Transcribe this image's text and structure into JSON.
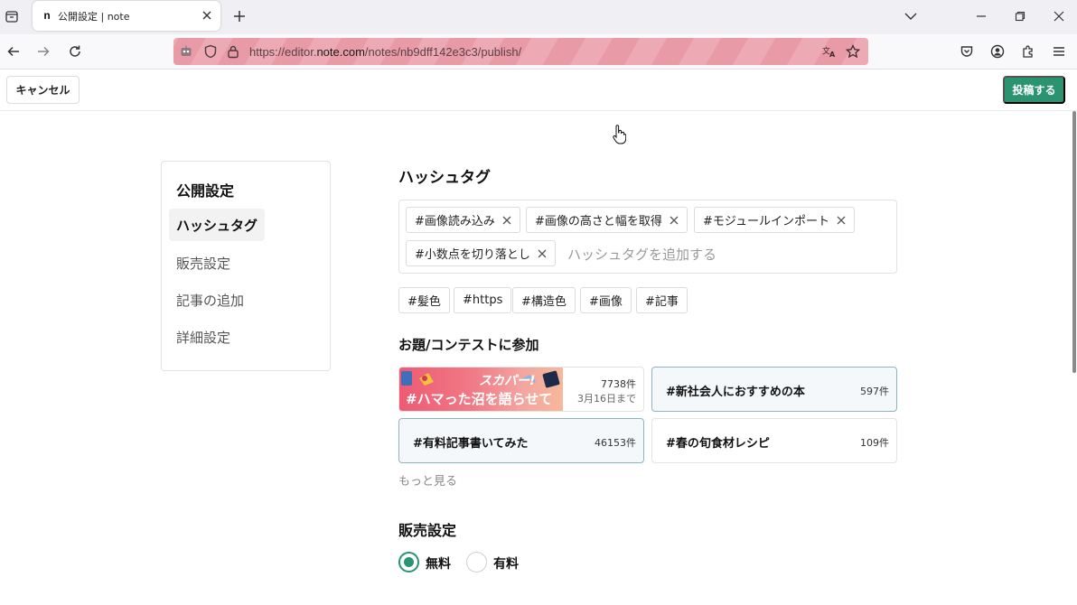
{
  "browser": {
    "tab": {
      "favicon": "n",
      "title": "公開設定 | note"
    },
    "url": {
      "prefix": "https://editor.",
      "host": "note.com",
      "path": "/notes/nb9dff142e3c3/publish/"
    },
    "icons": {
      "tab_list": "tab-list-icon",
      "new_tab": "plus-icon",
      "back": "arrow-left-icon",
      "forward": "arrow-right-icon",
      "reload": "reload-icon",
      "translate": "translate-icon",
      "bookmark": "star-icon",
      "pocket": "pocket-icon",
      "account": "account-icon",
      "extensions": "puzzle-icon",
      "menu": "hamburger-icon"
    }
  },
  "header": {
    "cancel_label": "キャンセル",
    "publish_label": "投稿する"
  },
  "sidebar": {
    "title": "公開設定",
    "items": [
      {
        "label": "ハッシュタグ",
        "active": true
      },
      {
        "label": "販売設定",
        "active": false
      },
      {
        "label": "記事の追加",
        "active": false
      },
      {
        "label": "詳細設定",
        "active": false
      }
    ]
  },
  "hashtags": {
    "heading": "ハッシュタグ",
    "selected": [
      "#画像読み込み",
      "#画像の高さと幅を取得",
      "#モジュールインポート",
      "#小数点を切り落とし"
    ],
    "input_placeholder": "ハッシュタグを追加する",
    "suggestions": [
      "#髪色",
      "#https",
      "#構造色",
      "#画像",
      "#記事"
    ]
  },
  "contest": {
    "heading": "お題/コンテストに参加",
    "featured": {
      "banner_top": "スカパー!",
      "banner_bottom": "#ハマった沼を語らせて",
      "count": "7738件",
      "deadline": "3月16日まで"
    },
    "cards": [
      {
        "name": "#新社会人におすすめの本",
        "count": "597件",
        "selected": true
      },
      {
        "name": "#有料記事書いてみた",
        "count": "46153件",
        "selected": true
      },
      {
        "name": "#春の旬食材レシピ",
        "count": "109件",
        "selected": false
      }
    ],
    "more_label": "もっと見る"
  },
  "sales": {
    "heading": "販売設定",
    "options": [
      {
        "label": "無料",
        "checked": true
      },
      {
        "label": "有料",
        "checked": false
      }
    ]
  },
  "colors": {
    "accent": "#2a9470",
    "url_stripe_light": "#eeaab4",
    "url_stripe_dark": "#e89aa6"
  }
}
